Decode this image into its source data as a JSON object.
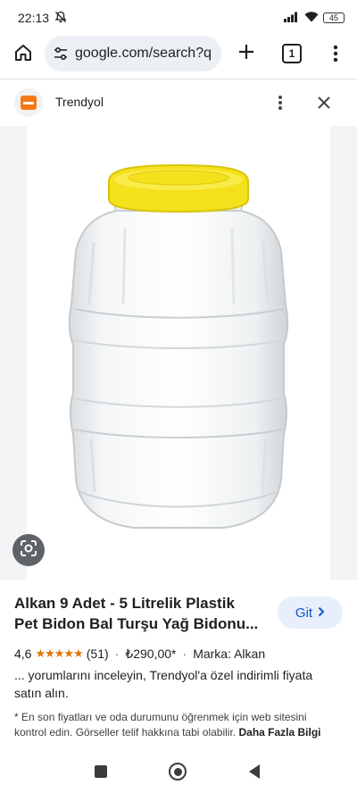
{
  "status_bar": {
    "time": "22:13",
    "battery": "45"
  },
  "browser": {
    "url": "google.com/search?q",
    "tab_count": "1"
  },
  "source": {
    "name": "Trendyol"
  },
  "product": {
    "title_line1": "Alkan 9 Adet - 5 Litrelik Plastik",
    "title_line2": "Pet Bidon Bal Turşu Yağ Bidonu...",
    "rating": "4,6",
    "stars": "★★★★★",
    "reviews": "(51)",
    "separator": "·",
    "price": "₺290,00*",
    "brand": "Marka: Alkan",
    "go_label": "Git",
    "description": "... yorumlarını inceleyin, Trendyol'a özel indirimli fiyata satın alın.",
    "footnote": "* En son fiyatları ve oda durumunu öğrenmek için web sitesini kontrol edin. Görseller telif hakkına tabi olabilir.",
    "more_info": "Daha Fazla Bilgi"
  },
  "colors": {
    "accent": "#0b57d0",
    "star": "#e37400",
    "cap_yellow": "#f4e11c",
    "brand_orange": "#f27a1a"
  },
  "icons": {
    "status": [
      "mute-bell-icon",
      "signal-icon",
      "wifi-icon",
      "battery-icon"
    ],
    "browser": [
      "home-icon",
      "site-settings-icon",
      "new-tab-icon",
      "tab-switcher-icon",
      "overflow-menu-icon"
    ],
    "panel": [
      "more-vert-icon",
      "close-icon",
      "lens-icon",
      "chevron-right-icon"
    ],
    "nav": [
      "recents-icon",
      "home-nav-icon",
      "back-icon"
    ]
  }
}
